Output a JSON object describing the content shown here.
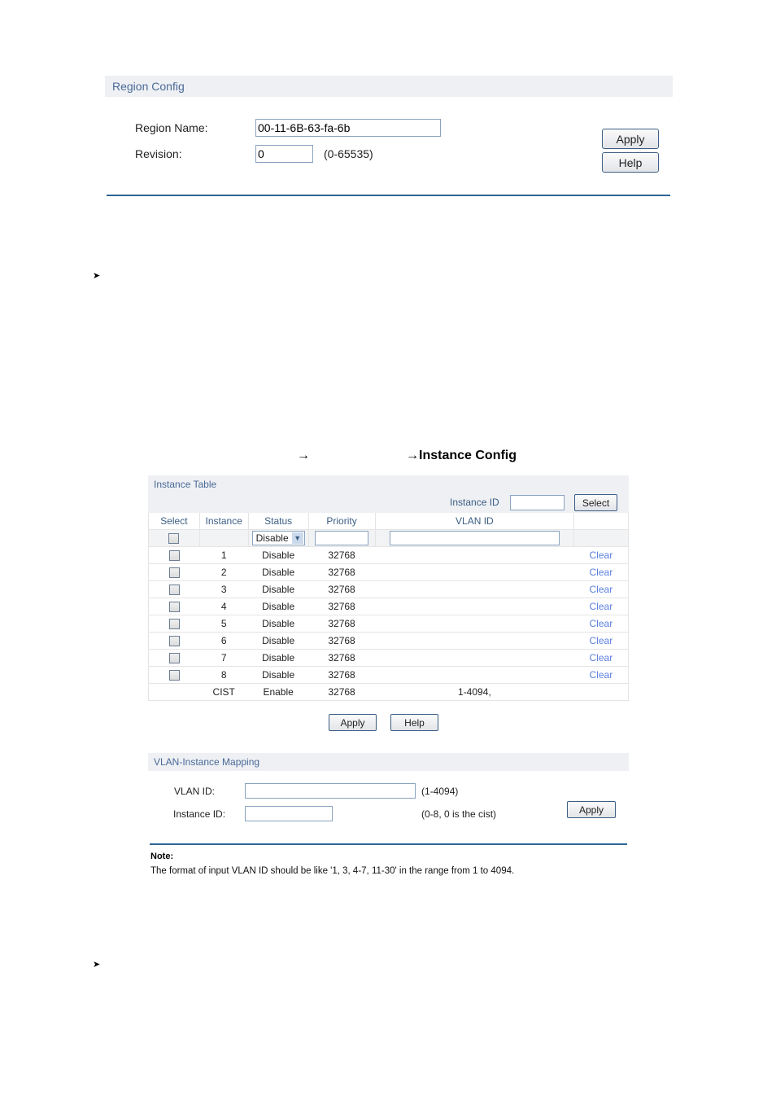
{
  "region_config": {
    "title": "Region Config",
    "region_name_label": "Region Name:",
    "region_name_value": "00-11-6B-63-fa-6b",
    "revision_label": "Revision:",
    "revision_value": "0",
    "revision_hint": "(0-65535)",
    "apply_label": "Apply",
    "help_label": "Help"
  },
  "bullets": {
    "first": "➤",
    "second": "➤"
  },
  "caption": {
    "arrow1": "→",
    "arrow2_text": "→Instance Config"
  },
  "instance_table": {
    "title": "Instance Table",
    "instance_id_label": "Instance ID",
    "instance_id_value": "",
    "select_button": "Select",
    "columns": [
      "Select",
      "Instance",
      "Status",
      "Priority",
      "VLAN ID",
      ""
    ],
    "edit_row": {
      "status_selected": "Disable",
      "priority_value": "",
      "vlan_value": ""
    },
    "rows": [
      {
        "instance": "1",
        "status": "Disable",
        "priority": "32768",
        "vlan": "",
        "action": "Clear",
        "checked": false
      },
      {
        "instance": "2",
        "status": "Disable",
        "priority": "32768",
        "vlan": "",
        "action": "Clear",
        "checked": false
      },
      {
        "instance": "3",
        "status": "Disable",
        "priority": "32768",
        "vlan": "",
        "action": "Clear",
        "checked": false
      },
      {
        "instance": "4",
        "status": "Disable",
        "priority": "32768",
        "vlan": "",
        "action": "Clear",
        "checked": false
      },
      {
        "instance": "5",
        "status": "Disable",
        "priority": "32768",
        "vlan": "",
        "action": "Clear",
        "checked": false
      },
      {
        "instance": "6",
        "status": "Disable",
        "priority": "32768",
        "vlan": "",
        "action": "Clear",
        "checked": false
      },
      {
        "instance": "7",
        "status": "Disable",
        "priority": "32768",
        "vlan": "",
        "action": "Clear",
        "checked": false
      },
      {
        "instance": "8",
        "status": "Disable",
        "priority": "32768",
        "vlan": "",
        "action": "Clear",
        "checked": false
      }
    ],
    "cist_row": {
      "instance": "CIST",
      "status": "Enable",
      "priority": "32768",
      "vlan": "1-4094,"
    },
    "apply_label": "Apply",
    "help_label": "Help"
  },
  "mapping": {
    "title": "VLAN-Instance Mapping",
    "vlan_label": "VLAN ID:",
    "vlan_value": "",
    "vlan_hint": "(1-4094)",
    "instance_label": "Instance ID:",
    "instance_value": "",
    "instance_hint": "(0-8, 0 is the cist)",
    "apply_label": "Apply"
  },
  "note": {
    "title": "Note:",
    "text": "The format of input VLAN ID should be like '1, 3, 4-7, 11-30' in the range from 1 to 4094."
  }
}
